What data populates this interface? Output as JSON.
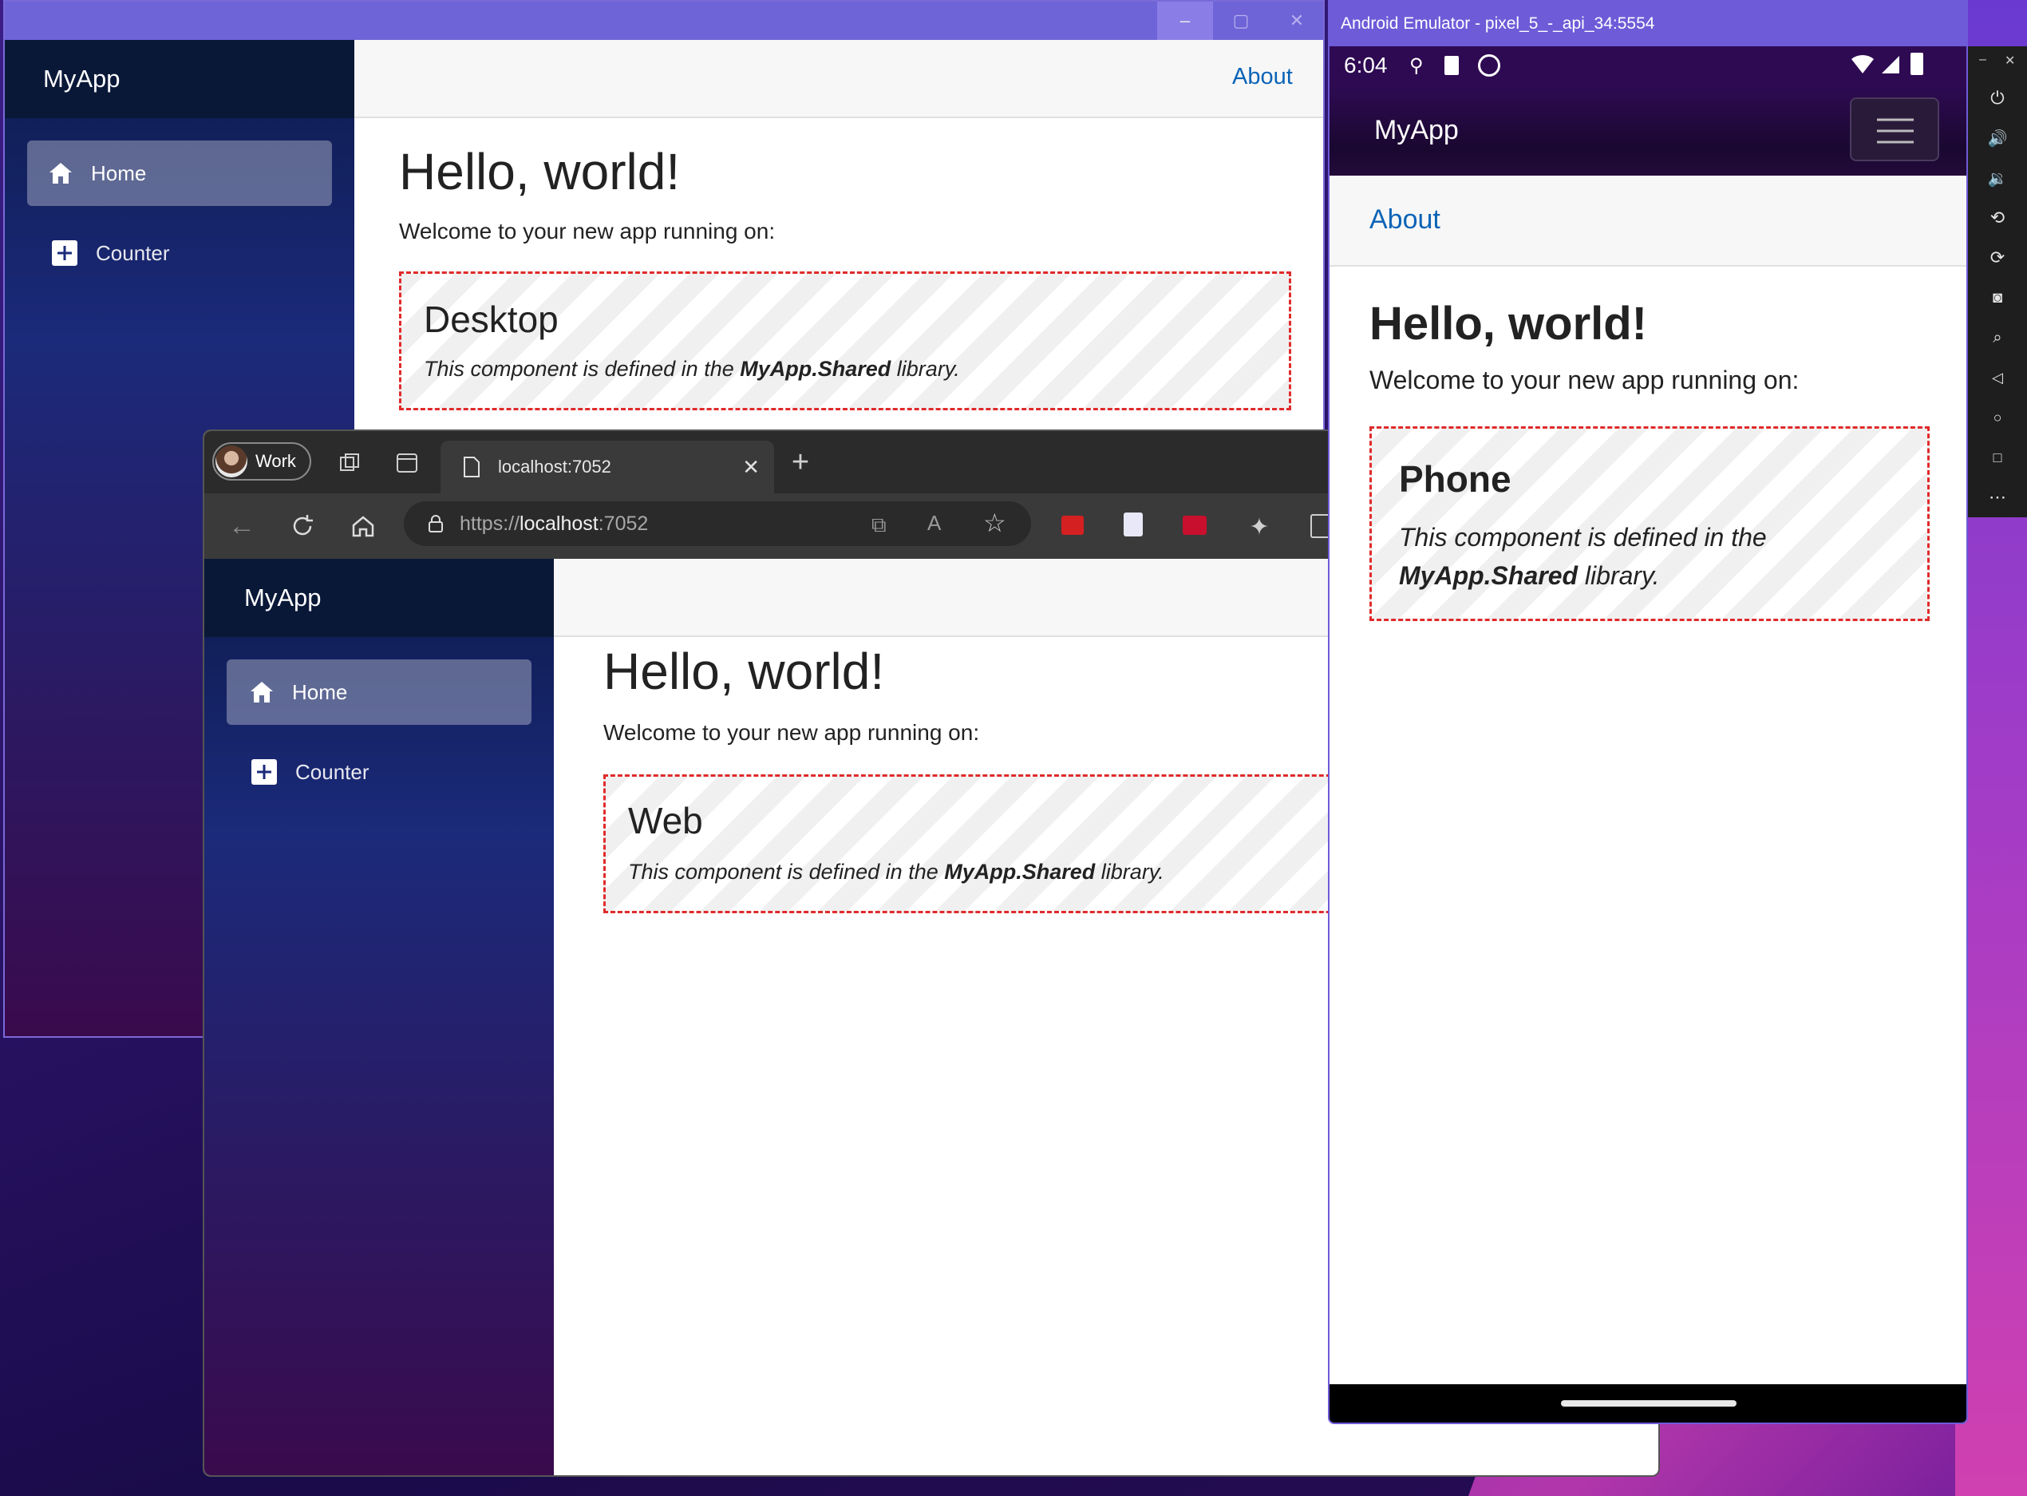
{
  "desktop": {
    "window_controls": [
      "–",
      "▢",
      "✕"
    ],
    "brand": "MyApp",
    "nav": [
      {
        "label": "Home",
        "icon": "home-icon",
        "active": true
      },
      {
        "label": "Counter",
        "icon": "plus-icon",
        "active": false
      }
    ],
    "top_link": "About",
    "heading": "Hello, world!",
    "welcome": "Welcome to your new app running on:",
    "platform": "Desktop",
    "desc_pre": "This component is defined in the",
    "desc_lib": "MyApp.Shared",
    "desc_post": "library."
  },
  "browser": {
    "profile": "Work",
    "tab_title": "localhost:7052",
    "url_prefix": "https://",
    "url_host": "localhost",
    "url_port": ":7052",
    "app": {
      "brand": "MyApp",
      "nav": [
        {
          "label": "Home",
          "icon": "home-icon",
          "active": true
        },
        {
          "label": "Counter",
          "icon": "plus-icon",
          "active": false
        }
      ],
      "heading": "Hello, world!",
      "welcome": "Welcome to your new app running on:",
      "platform": "Web",
      "desc_pre": "This component is defined in the",
      "desc_lib": "MyApp.Shared",
      "desc_post": "library."
    }
  },
  "emulator": {
    "title": "Android Emulator - pixel_5_-_api_34:5554",
    "time": "6:04",
    "brand": "MyApp",
    "top_link": "About",
    "heading": "Hello, world!",
    "welcome": "Welcome to your new app running on:",
    "platform": "Phone",
    "desc_line1": "This component is defined in the",
    "desc_lib": "MyApp.Shared",
    "desc_post": "library.",
    "side_controls": [
      "–",
      "✕"
    ]
  },
  "colors": {
    "link": "#0b63b6",
    "dash_border": "#e02a2a",
    "emulator_titlebar": "#6e5bd8",
    "desktop_titlebar": "#6e64d8"
  }
}
